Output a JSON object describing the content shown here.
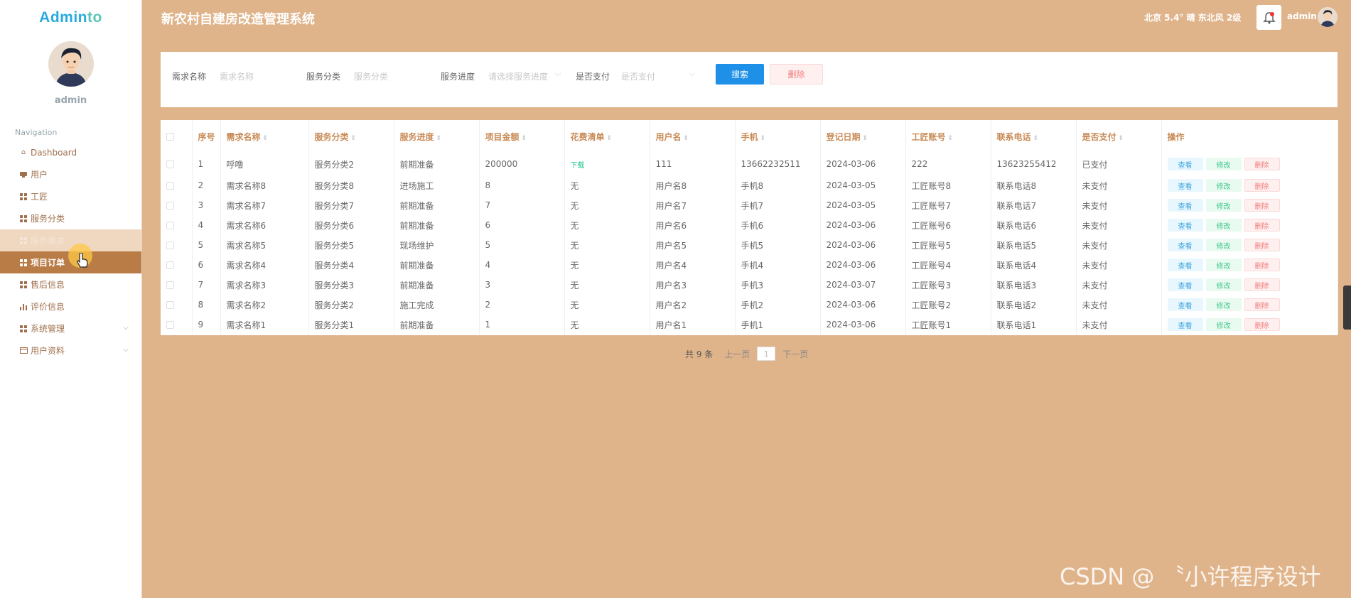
{
  "brand": {
    "part1": "Admin",
    "part2": "to"
  },
  "sidebar": {
    "user": "admin",
    "caption": "Navigation",
    "items": [
      {
        "label": "Dashboard",
        "icon": "home-icon"
      },
      {
        "label": "用户",
        "icon": "user-card-icon"
      },
      {
        "label": "工匠",
        "icon": "grid-icon"
      },
      {
        "label": "服务分类",
        "icon": "grid-icon"
      },
      {
        "label": "服务需求",
        "icon": "grid-icon"
      },
      {
        "label": "项目订单",
        "icon": "grid-icon"
      },
      {
        "label": "售后信息",
        "icon": "grid-icon"
      },
      {
        "label": "评价信息",
        "icon": "bar-chart-icon"
      },
      {
        "label": "系统管理",
        "icon": "grid-icon"
      },
      {
        "label": "用户资料",
        "icon": "profile-icon"
      }
    ]
  },
  "header": {
    "title": "新农村自建房改造管理系统",
    "weather": "北京  5.4°  晴  东北风  2级",
    "username": "admin"
  },
  "search": {
    "label_demand": "需求名称",
    "placeholder_demand": "需求名称",
    "label_category": "服务分类",
    "placeholder_category": "服务分类",
    "label_progress": "服务进度",
    "placeholder_progress": "请选择服务进度",
    "label_paid": "是否支付",
    "placeholder_paid": "是否支付",
    "search_btn": "搜索",
    "delete_btn": "删除"
  },
  "table": {
    "headers": [
      "序号",
      "需求名称",
      "服务分类",
      "服务进度",
      "项目金额",
      "花费清单",
      "用户名",
      "手机",
      "登记日期",
      "工匠账号",
      "联系电话",
      "是否支付",
      "操作"
    ],
    "rows": [
      [
        "1",
        "呼噜",
        "服务分类2",
        "前期准备",
        "200000",
        "下载",
        "111",
        "13662232511",
        "2024-03-06",
        "222",
        "13623255412",
        "已支付"
      ],
      [
        "2",
        "需求名称8",
        "服务分类8",
        "进场施工",
        "8",
        "无",
        "用户名8",
        "手机8",
        "2024-03-05",
        "工匠账号8",
        "联系电话8",
        "未支付"
      ],
      [
        "3",
        "需求名称7",
        "服务分类7",
        "前期准备",
        "7",
        "无",
        "用户名7",
        "手机7",
        "2024-03-05",
        "工匠账号7",
        "联系电话7",
        "未支付"
      ],
      [
        "4",
        "需求名称6",
        "服务分类6",
        "前期准备",
        "6",
        "无",
        "用户名6",
        "手机6",
        "2024-03-06",
        "工匠账号6",
        "联系电话6",
        "未支付"
      ],
      [
        "5",
        "需求名称5",
        "服务分类5",
        "现场维护",
        "5",
        "无",
        "用户名5",
        "手机5",
        "2024-03-06",
        "工匠账号5",
        "联系电话5",
        "未支付"
      ],
      [
        "6",
        "需求名称4",
        "服务分类4",
        "前期准备",
        "4",
        "无",
        "用户名4",
        "手机4",
        "2024-03-06",
        "工匠账号4",
        "联系电话4",
        "未支付"
      ],
      [
        "7",
        "需求名称3",
        "服务分类3",
        "前期准备",
        "3",
        "无",
        "用户名3",
        "手机3",
        "2024-03-07",
        "工匠账号3",
        "联系电话3",
        "未支付"
      ],
      [
        "8",
        "需求名称2",
        "服务分类2",
        "施工完成",
        "2",
        "无",
        "用户名2",
        "手机2",
        "2024-03-06",
        "工匠账号2",
        "联系电话2",
        "未支付"
      ],
      [
        "9",
        "需求名称1",
        "服务分类1",
        "前期准备",
        "1",
        "无",
        "用户名1",
        "手机1",
        "2024-03-06",
        "工匠账号1",
        "联系电话1",
        "未支付"
      ]
    ],
    "actions": {
      "view": "查看",
      "edit": "修改",
      "delete": "删除"
    }
  },
  "pagination": {
    "total": "共 9 条",
    "prev": "上一页",
    "current": "1",
    "next": "下一页"
  },
  "watermark": "CSDN @ 〝小许程序设计",
  "colors": {
    "background": "#e0b48b",
    "active_nav": "#b97c47",
    "primary_button": "#1e90e8",
    "header_text": "#c88a55"
  }
}
